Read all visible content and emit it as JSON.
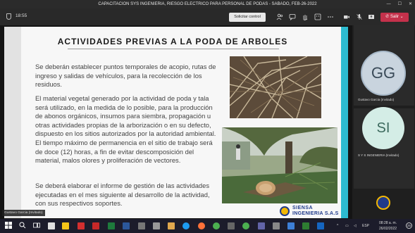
{
  "window": {
    "title": "CAPACITACION SYS INGENIERIA, RIESGO ELECTRICO PARA PERSONAL DE PODAS - SABADO, FEB-26-2022",
    "minimize": "—",
    "maximize": "☐",
    "close": "✕"
  },
  "toolbar": {
    "time": "18:55",
    "request_control": "Solicitar control",
    "leave": "Salir",
    "icons": [
      "people-icon",
      "chat-icon",
      "raise-hand-icon",
      "reactions-icon",
      "more-icon",
      "camera-icon",
      "mic-icon",
      "share-icon"
    ]
  },
  "slide": {
    "title": "ACTIVIDADES PREVIAS A LA PODA DE ARBOLES",
    "paragraphs": [
      "Se deberán establecer puntos temporales de acopio, rutas de ingreso y salidas de vehículos, para la recolección de los residuos.",
      "El material vegetal generado por la actividad de poda y tala será utilizado, en la medida de lo posible, para la producción de abonos orgánicos, insumos para siembra, propagación u otras actividades propias de la arborización o en su defecto, dispuesto en los sitios autorizados por la autoridad ambiental. El tiempo máximo de permanencia en el sitio de trabajo será de doce (12) horas, a fin de evitar descomposición del material, malos olores y proliferación de vectores.",
      "Se deberá elaborar el informe de gestión de las actividades ejecutadas en el mes siguiente al desarrollo de la actividad, con sus respectivos soportes."
    ],
    "logo_line1": "SIENSA",
    "logo_line2": "INGENIERIA S.A.S"
  },
  "presenter_tag": "Gustavo Garcia (Invitado)",
  "participants": [
    {
      "initials": "GG",
      "name": "Gustavo Garcia (Invitado)"
    },
    {
      "initials": "SI",
      "name": "S Y S INGENIERIA (Invitado)"
    }
  ],
  "taskbar": {
    "lang": "ESP",
    "clock_time": "08:28 a. m.",
    "clock_date": "26/02/2022",
    "notifications": "25"
  },
  "colors": {
    "leave": "#c4314b",
    "slide_accent": "#2dbbd0",
    "taskbar": "#1c1c2b"
  }
}
